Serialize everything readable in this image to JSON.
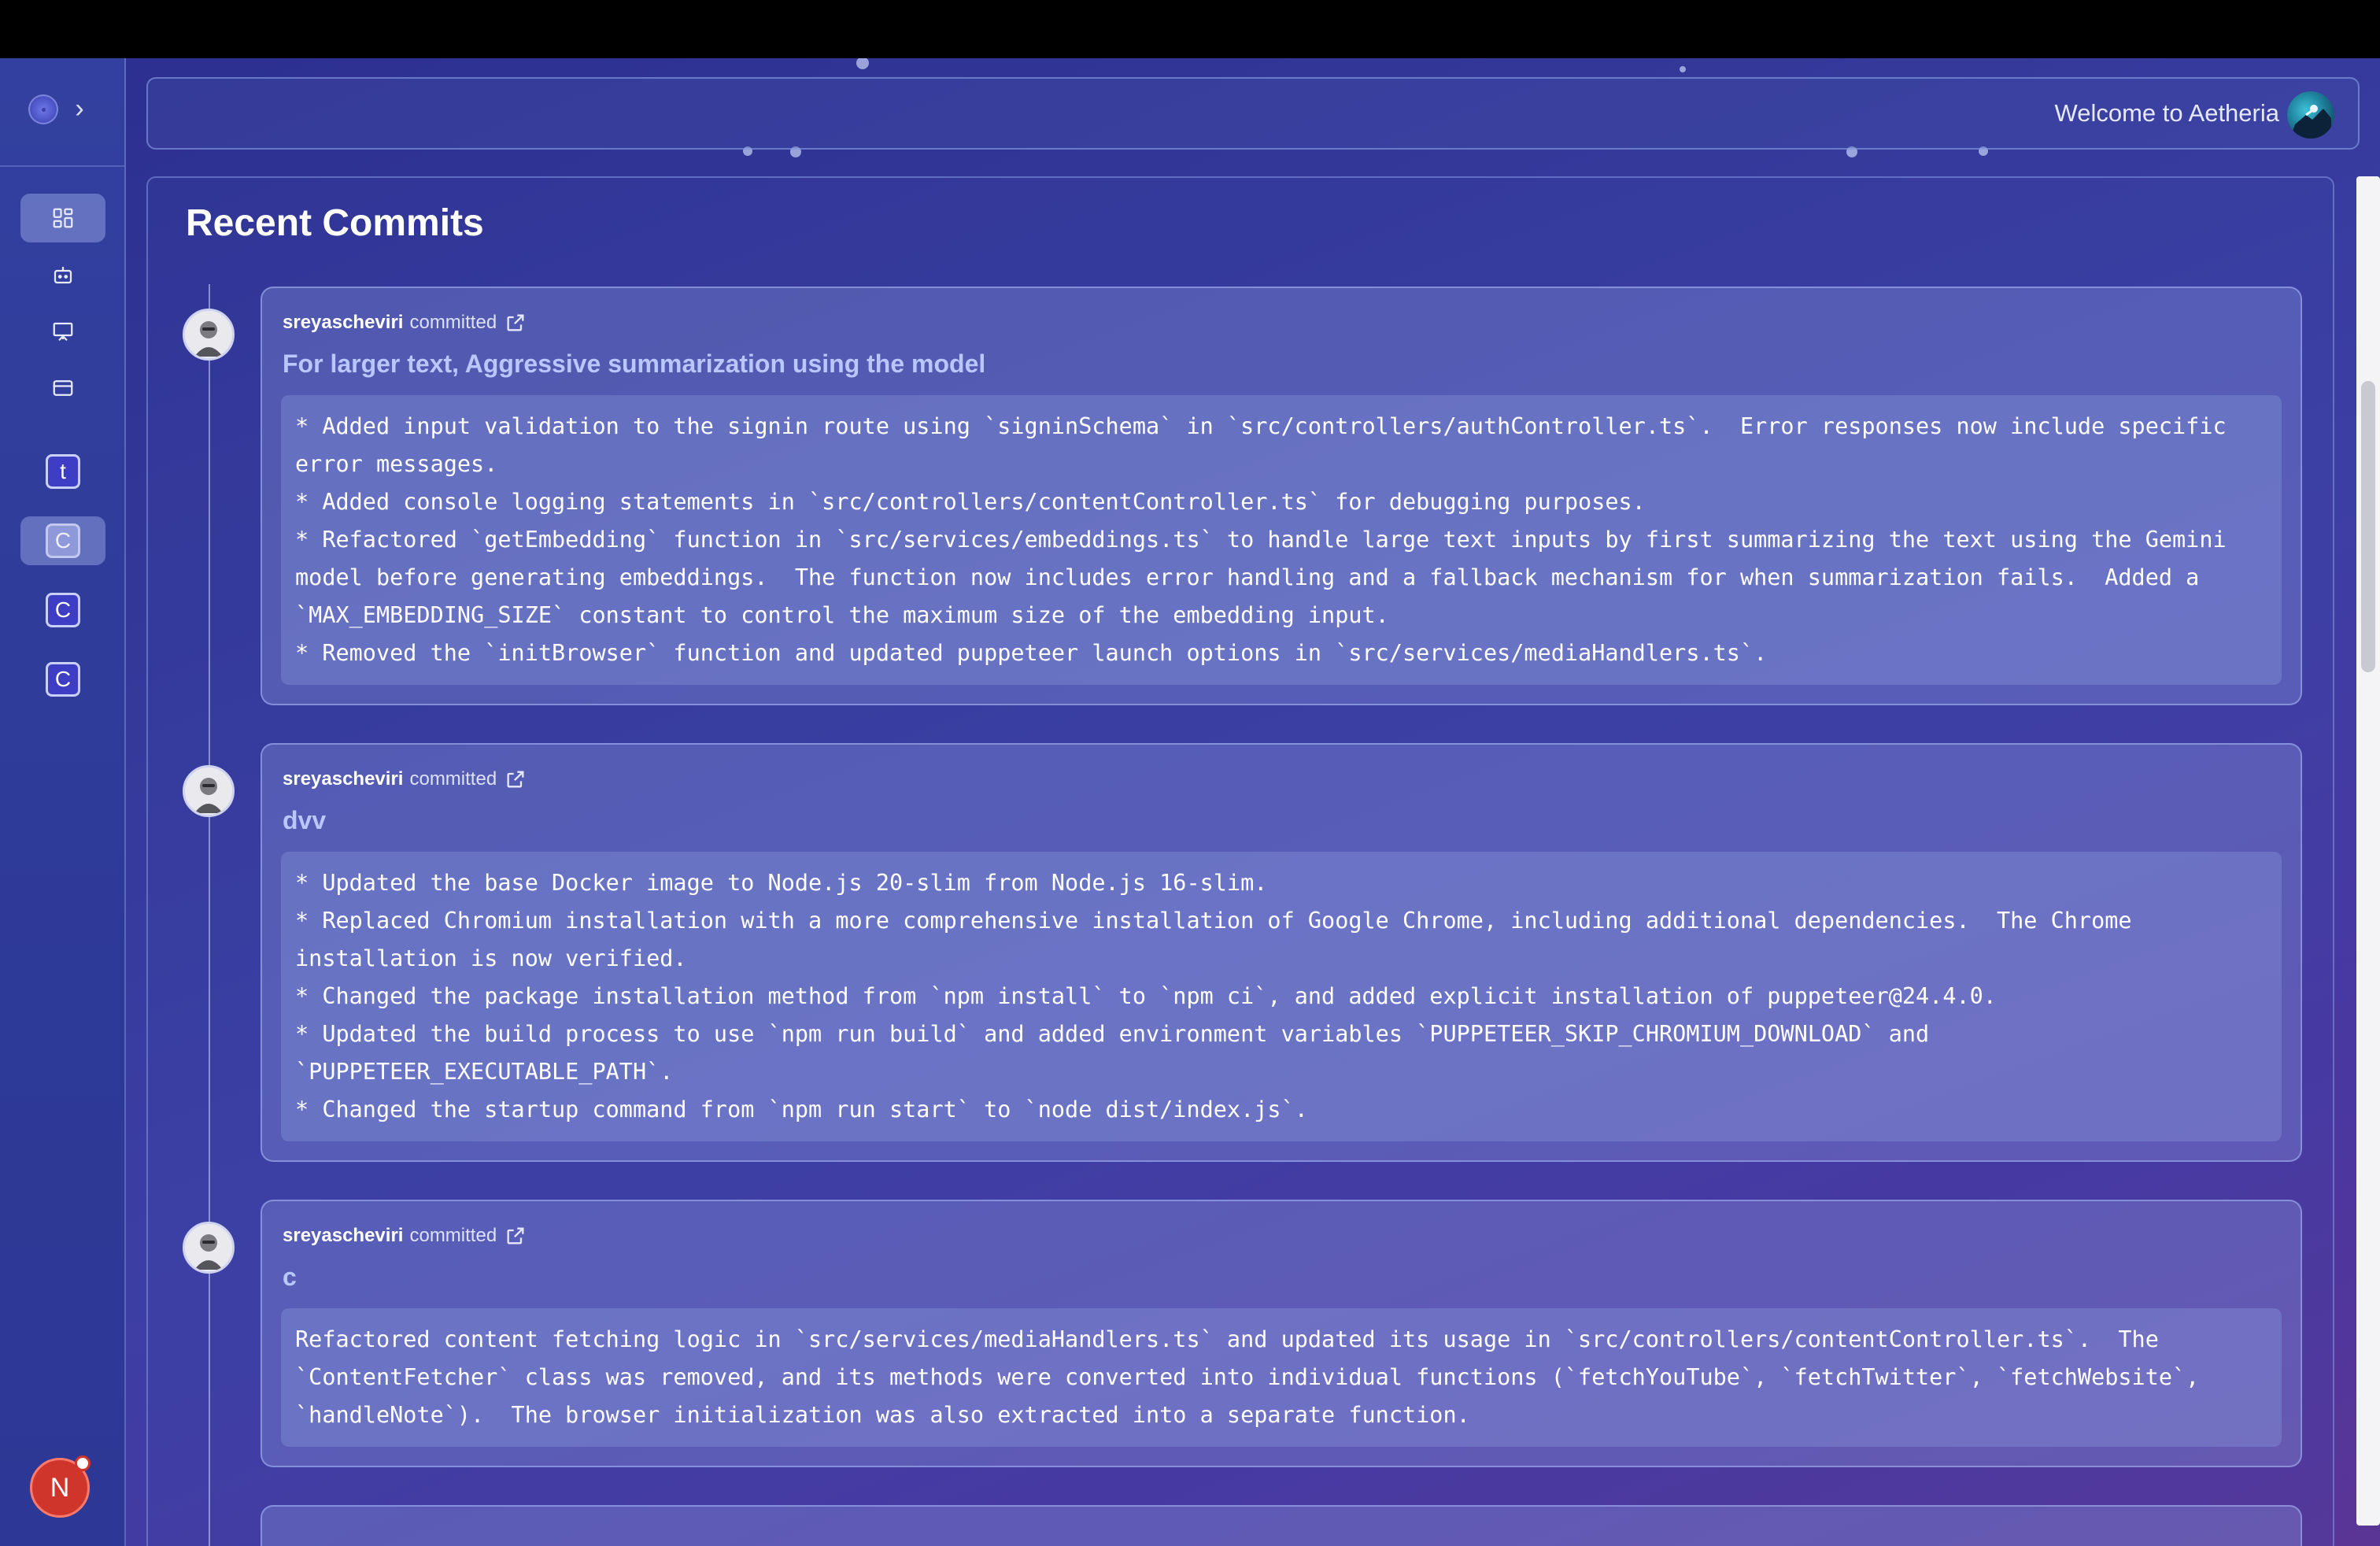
{
  "app": {
    "welcome_text": "Welcome to Aetheria"
  },
  "colors": {
    "accent": "#b8c8ff",
    "sidebar": "#3040a0",
    "avatar_bg": "#d0352c"
  },
  "sidebar": {
    "items": [
      {
        "icon": "dashboard-grid-icon"
      },
      {
        "icon": "bot-icon"
      },
      {
        "icon": "presentation-icon"
      },
      {
        "icon": "card-icon"
      },
      {
        "letter": "t"
      },
      {
        "letter": "C"
      },
      {
        "letter": "C"
      },
      {
        "letter": "C"
      }
    ],
    "user_initial": "N"
  },
  "main": {
    "title": "Recent Commits",
    "commits": [
      {
        "author": "sreyascheviri",
        "verb": "committed",
        "title": "For larger text, Aggressive summarization using the model",
        "lines": [
          "* Added input validation to the signin route using `signinSchema` in `src/controllers/authController.ts`.  Error responses now include specific error messages.",
          "* Added console logging statements in `src/controllers/contentController.ts` for debugging purposes.",
          "* Refactored `getEmbedding` function in `src/services/embeddings.ts` to handle large text inputs by first summarizing the text using the Gemini model before generating embeddings.  The function now includes error handling and a fallback mechanism for when summarization fails.  Added a `MAX_EMBEDDING_SIZE` constant to control the maximum size of the embedding input.",
          "* Removed the `initBrowser` function and updated puppeteer launch options in `src/services/mediaHandlers.ts`."
        ]
      },
      {
        "author": "sreyascheviri",
        "verb": "committed",
        "title": "dvv",
        "lines": [
          "* Updated the base Docker image to Node.js 20-slim from Node.js 16-slim.",
          "* Replaced Chromium installation with a more comprehensive installation of Google Chrome, including additional dependencies.  The Chrome installation is now verified.",
          "* Changed the package installation method from `npm install` to `npm ci`, and added explicit installation of puppeteer@24.4.0.",
          "* Updated the build process to use `npm run build` and added environment variables `PUPPETEER_SKIP_CHROMIUM_DOWNLOAD` and `PUPPETEER_EXECUTABLE_PATH`.",
          "* Changed the startup command from `npm run start` to `node dist/index.js`."
        ]
      },
      {
        "author": "sreyascheviri",
        "verb": "committed",
        "title": "c",
        "lines": [
          "Refactored content fetching logic in `src/services/mediaHandlers.ts` and updated its usage in `src/controllers/contentController.ts`.  The `ContentFetcher` class was removed, and its methods were converted into individual functions (`fetchYouTube`, `fetchTwitter`, `fetchWebsite`, `handleNote`).  The browser initialization was also extracted into a separate function."
        ]
      }
    ]
  }
}
